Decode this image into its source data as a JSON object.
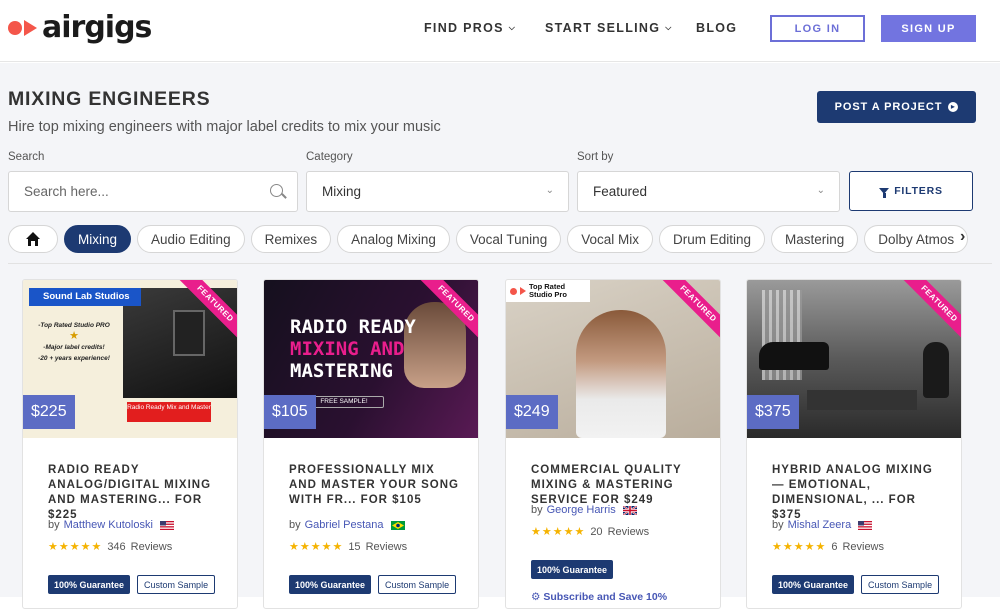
{
  "header": {
    "logo_text": "airgigs",
    "nav": [
      {
        "label": "FIND PROS",
        "has_dropdown": true
      },
      {
        "label": "START SELLING",
        "has_dropdown": true
      },
      {
        "label": "BLOG",
        "has_dropdown": false
      }
    ],
    "login_label": "LOG IN",
    "signup_label": "SIGN UP"
  },
  "page": {
    "title": "MIXING ENGINEERS",
    "subtitle": "Hire top mixing engineers with major label credits to mix your music",
    "post_project_label": "POST A PROJECT"
  },
  "filters": {
    "search_label": "Search",
    "search_placeholder": "Search here...",
    "category_label": "Category",
    "category_value": "Mixing",
    "sort_label": "Sort by",
    "sort_value": "Featured",
    "filters_button": "FILTERS"
  },
  "chips": [
    "Mixing",
    "Audio Editing",
    "Remixes",
    "Analog Mixing",
    "Vocal Tuning",
    "Vocal Mix",
    "Drum Editing",
    "Mastering",
    "Dolby Atmos"
  ],
  "active_chip": "Mixing",
  "ribbon_label": "FEATURED",
  "guarantee_label": "100% Guarantee",
  "custom_sample_label": "Custom Sample",
  "by_label": "by",
  "reviews_label": "Reviews",
  "cards": [
    {
      "price": "$225",
      "title": "RADIO READY ANALOG/DIGITAL MIXING AND MASTERING... FOR $225",
      "seller": "Matthew Kutoloski",
      "flag": "us",
      "rating": 5,
      "reviews": "346",
      "thumb_lines": [
        "Sound Lab Studios",
        "-Top Rated Studio PRO",
        "-Major label credits!",
        "-20 + years experience!",
        "Radio Ready Mix and Master"
      ]
    },
    {
      "price": "$105",
      "title": "PROFESSIONALLY MIX AND MASTER YOUR SONG WITH FR... FOR $105",
      "seller": "Gabriel Pestana",
      "flag": "br",
      "rating": 5,
      "reviews": "15",
      "thumb_lines": [
        "RADIO READY",
        "MIXING AND",
        "MASTERING",
        "FREE SAMPLE!"
      ]
    },
    {
      "price": "$249",
      "title": "COMMERCIAL QUALITY MIXING & MASTERING SERVICE FOR $249",
      "seller": "George Harris",
      "flag": "gb",
      "rating": 5,
      "reviews": "20",
      "thumb_lines": [
        "Top Rated",
        "Studio Pro"
      ],
      "extra": "Subscribe and Save 10%"
    },
    {
      "price": "$375",
      "title": "HYBRID ANALOG MIXING — EMOTIONAL, DIMENSIONAL, ... FOR $375",
      "seller": "Mishal Zeera",
      "flag": "us",
      "rating": 5,
      "reviews": "6",
      "thumb_lines": []
    }
  ],
  "colors": {
    "brand_red": "#f4564a",
    "accent": "#7274e0",
    "navy": "#1d3a72",
    "featured": "#e91e8c",
    "price_bg": "#5c6cc4"
  }
}
